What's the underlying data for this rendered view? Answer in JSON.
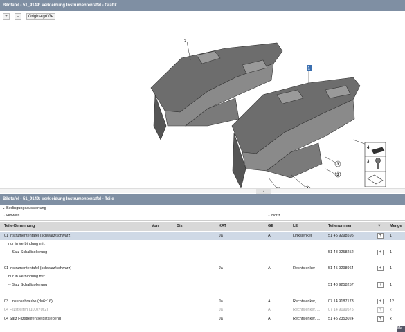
{
  "graphic_panel": {
    "title": "Bildtafel - 51_9149: Verkleidung Instrumententafel - Grafik",
    "zoom_in_label": "+",
    "zoom_out_label": "-",
    "original_size_label": "Originalgröße",
    "callouts": [
      "2",
      "1",
      "3",
      "3",
      "4",
      "3",
      "3"
    ],
    "legend": {
      "item_4": "4",
      "item_3": "3"
    }
  },
  "parts_panel": {
    "title": "Bildtafel - 51_9149: Verkleidung Instrumententafel - Teile",
    "filter_bedingung": "Bedingungsauswertung",
    "filter_hinweis": "Hinweis",
    "filter_notiz": "Notiz",
    "columns": {
      "name": "Teile-Benennung",
      "von": "Von",
      "bis": "Bis",
      "kat": "KAT",
      "ge": "GE",
      "le": "LE",
      "teil": "Teilenummer",
      "sort": "▼",
      "menge": "Menge"
    },
    "rows": [
      {
        "name": "01 Instrumententafel (schwarz/schwarz)",
        "kat": "Ja",
        "ge": "A",
        "le": "Linkslenker",
        "teil": "51 45 9298595",
        "menge": "1"
      },
      {
        "name": "nur in Verbindung mit:",
        "kat": "",
        "ge": "",
        "le": "",
        "teil": "",
        "menge": ""
      },
      {
        "name": "-- Satz Schallisolierung",
        "kat": "",
        "ge": "",
        "le": "",
        "teil": "51 48 9258252",
        "menge": "1"
      },
      {
        "name": "01 Instrumententafel (schwarz/schwarz)",
        "kat": "Ja",
        "ge": "A",
        "le": "Rechtslenker",
        "teil": "51 45 9298964",
        "menge": "1"
      },
      {
        "name": "nur in Verbindung mit:",
        "kat": "",
        "ge": "",
        "le": "",
        "teil": "",
        "menge": ""
      },
      {
        "name": "-- Satz Schallisolierung",
        "kat": "",
        "ge": "",
        "le": "",
        "teil": "51 48 9258257",
        "menge": "1"
      },
      {
        "name": "03 Linsenschraube (d=6x16)",
        "kat": "Ja",
        "ge": "A",
        "le": "Rechtslenker, ...",
        "teil": "07 14 9187173",
        "menge": "12"
      },
      {
        "name": "04 Filzstreifen (100x70x2)",
        "kat": "Ja",
        "ge": "A",
        "le": "Rechtslenker, ...",
        "teil": "07 14 9199575",
        "menge": "x"
      },
      {
        "name": "04 Satz Filzstreifen selbstklebend",
        "kat": "Ja",
        "ge": "A",
        "le": "Rechtslenker, ...",
        "teil": "51 45 2353024",
        "menge": "x"
      }
    ],
    "more_label": "Me"
  }
}
